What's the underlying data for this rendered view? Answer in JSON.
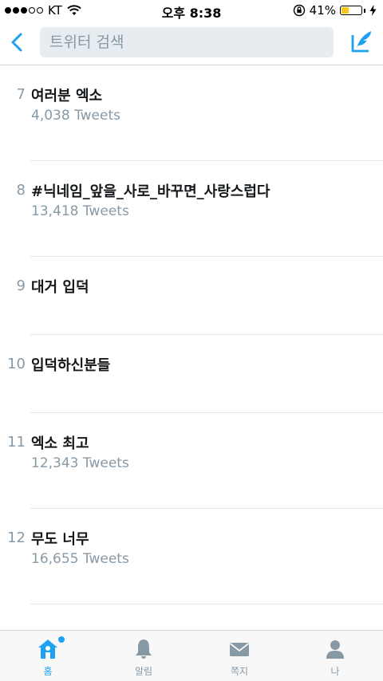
{
  "status_bar": {
    "carrier": "KT",
    "time": "오후 8:38",
    "battery": "41%",
    "battery_level": 0.41
  },
  "nav": {
    "search_placeholder": "트위터 검색"
  },
  "trends": [
    {
      "rank": "7",
      "title": "여러분 엑소",
      "count": "4,038 Tweets"
    },
    {
      "rank": "8",
      "title": "#닉네임_앞을_사로_바꾸면_사랑스럽다",
      "count": "13,418 Tweets"
    },
    {
      "rank": "9",
      "title": "대거 입덕",
      "count": ""
    },
    {
      "rank": "10",
      "title": "입덕하신분들",
      "count": ""
    },
    {
      "rank": "11",
      "title": "엑소 최고",
      "count": "12,343 Tweets"
    },
    {
      "rank": "12",
      "title": "무도 너무",
      "count": "16,655 Tweets"
    }
  ],
  "tabs": [
    {
      "label": "홈"
    },
    {
      "label": "알림"
    },
    {
      "label": "쪽지"
    },
    {
      "label": "나"
    }
  ],
  "colors": {
    "accent": "#1da1f2",
    "muted": "#8899a6",
    "battery": "#f5c518"
  }
}
